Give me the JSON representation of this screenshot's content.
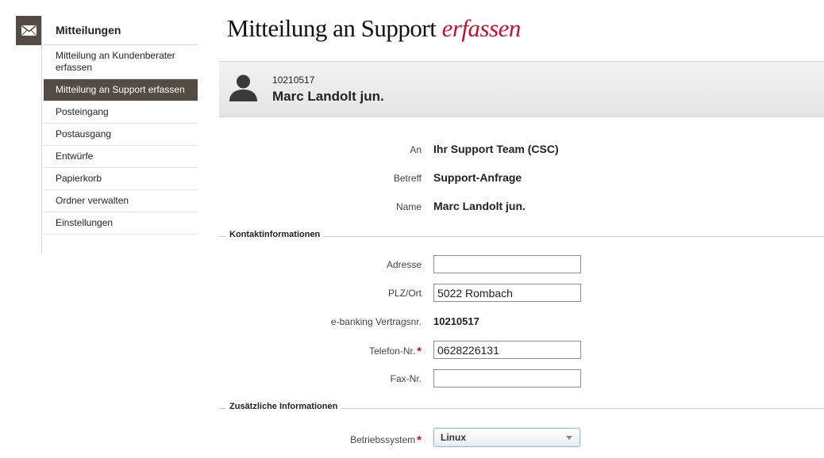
{
  "sidebar": {
    "title": "Mitteilungen",
    "items": [
      {
        "label": "Mitteilung an Kundenberater erfassen"
      },
      {
        "label": "Mitteilung an Support erfassen"
      },
      {
        "label": "Posteingang"
      },
      {
        "label": "Postausgang"
      },
      {
        "label": "Entwürfe"
      },
      {
        "label": "Papierkorb"
      },
      {
        "label": "Ordner verwalten"
      },
      {
        "label": "Einstellungen"
      }
    ],
    "active_item": "Mitteilung an Support erfassen"
  },
  "page": {
    "title_main": "Mitteilung an Support",
    "title_accent": "erfassen"
  },
  "profile": {
    "number": "10210517",
    "name": "Marc Landolt jun."
  },
  "message": {
    "to_label": "An",
    "to_value": "Ihr Support Team (CSC)",
    "subject_label": "Betreff",
    "subject_value": "Support-Anfrage",
    "name_label": "Name",
    "name_value": "Marc Landolt jun."
  },
  "contact": {
    "section_title": "Kontaktinformationen",
    "address_label": "Adresse",
    "address_value": "",
    "zip_city_label": "PLZ/Ort",
    "zip_city_value": "5022 Rombach",
    "contract_label": "e-banking Vertragsnr.",
    "contract_value": "10210517",
    "phone_label": "Telefon-Nr.",
    "phone_value": "0628226131",
    "fax_label": "Fax-Nr.",
    "fax_value": ""
  },
  "additional": {
    "section_title": "Zusätzliche Informationen",
    "os_label": "Betriebssystem",
    "os_value": "Linux"
  },
  "required_marker": "*",
  "colors": {
    "sidebar_dark": "#544c44",
    "accent_red": "#c8102e"
  }
}
